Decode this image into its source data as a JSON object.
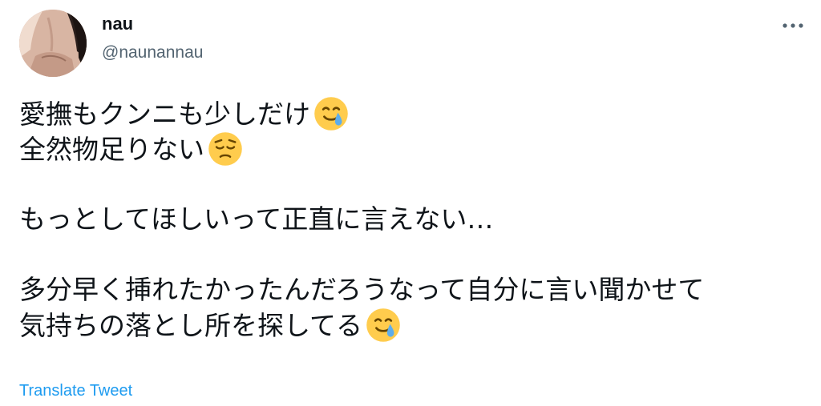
{
  "author": {
    "display_name": "nau",
    "handle": "@naunannau"
  },
  "tweet": {
    "lines": [
      "愛撫もクンニも少しだけ",
      "全然物足りない",
      "",
      "もっとしてほしいって正直に言えない…",
      "",
      "多分早く挿れたかったんだろうなって自分に言い聞かせて",
      "気持ちの落とし所を探してる"
    ],
    "emojis": {
      "line_1": "smiling-face-with-tear-emoji",
      "line_2": "pensive-face-emoji",
      "line_7": "smiling-face-with-tear-emoji"
    }
  },
  "actions": {
    "more_icon": "more-horizontal-icon",
    "translate_label": "Translate Tweet"
  },
  "colors": {
    "text": "#0f1419",
    "secondary": "#536471",
    "link": "#1d9bf0",
    "emoji_face": "#ffcc4d",
    "emoji_tear": "#5dadec"
  }
}
